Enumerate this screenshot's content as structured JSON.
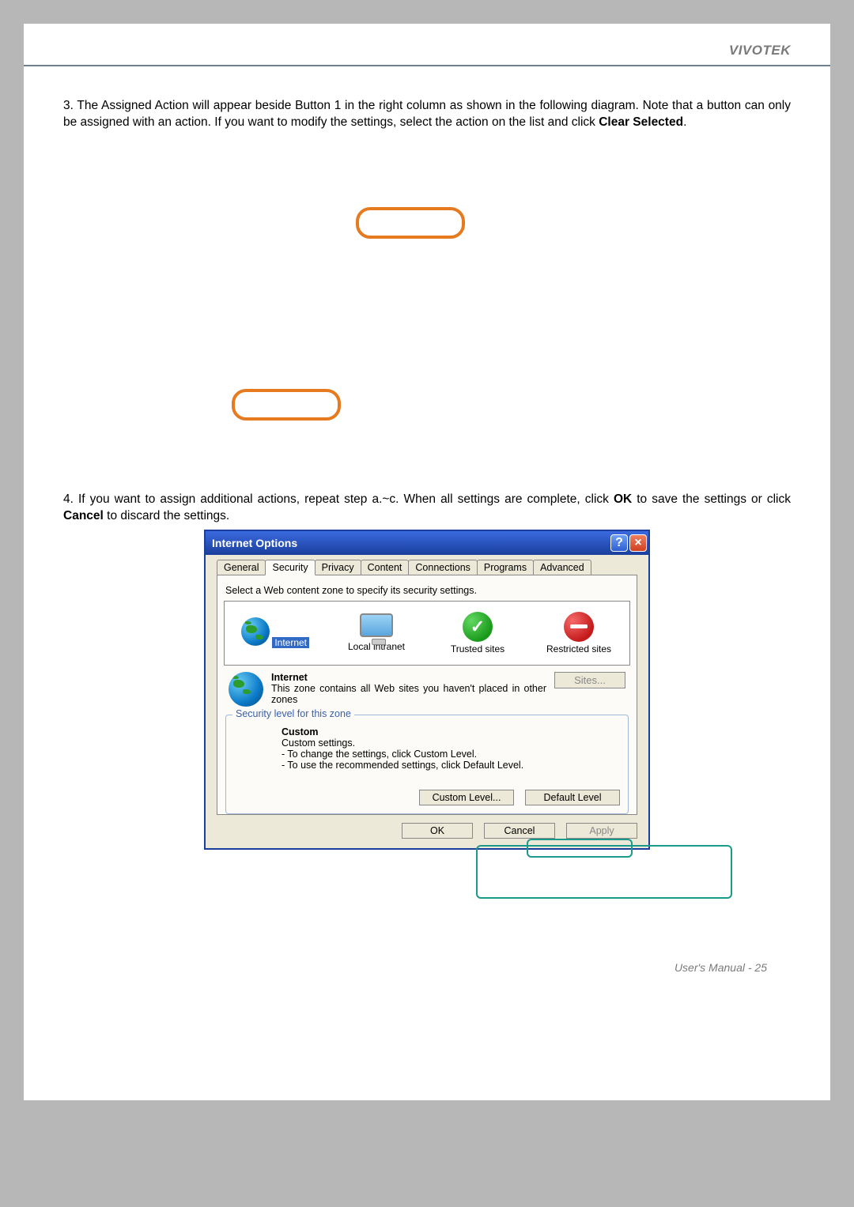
{
  "header": {
    "brand": "VIVOTEK"
  },
  "step3": {
    "num": "3.",
    "text_a": "The Assigned Action will appear beside Button 1 in the right column as shown in the following diagram. Note that a button can only be assigned with an action. If you want to modify the settings, select the action on the list and click ",
    "bold": "Clear Selected",
    "text_b": "."
  },
  "step4": {
    "num": "4.",
    "text_a": "If you want to assign additional actions, repeat step a.~c. When all settings are complete, click ",
    "bold1": "OK",
    "text_b": " to save the settings or click ",
    "bold2": "Cancel",
    "text_c": " to discard the settings."
  },
  "dialog": {
    "title": "Internet Options",
    "tabs": [
      "General",
      "Security",
      "Privacy",
      "Content",
      "Connections",
      "Programs",
      "Advanced"
    ],
    "active_tab_index": 1,
    "hint": "Select a Web content zone to specify its security settings.",
    "zones": [
      {
        "label": "Internet",
        "selected": true
      },
      {
        "label": "Local intranet",
        "selected": false
      },
      {
        "label": "Trusted sites",
        "selected": false
      },
      {
        "label": "Restricted sites",
        "selected": false
      }
    ],
    "zoneinfo": {
      "heading": "Internet",
      "desc": "This zone contains all Web sites you haven't placed in other zones",
      "sites_btn": "Sites..."
    },
    "security_legend": "Security level for this zone",
    "custom": {
      "heading": "Custom",
      "l1": "Custom settings.",
      "l2": "- To change the settings, click Custom Level.",
      "l3": "- To use the recommended settings, click Default Level."
    },
    "custom_level_btn": "Custom Level...",
    "default_level_btn": "Default Level",
    "ok_btn": "OK",
    "cancel_btn": "Cancel",
    "apply_btn": "Apply"
  },
  "footer": "User's Manual - 25"
}
